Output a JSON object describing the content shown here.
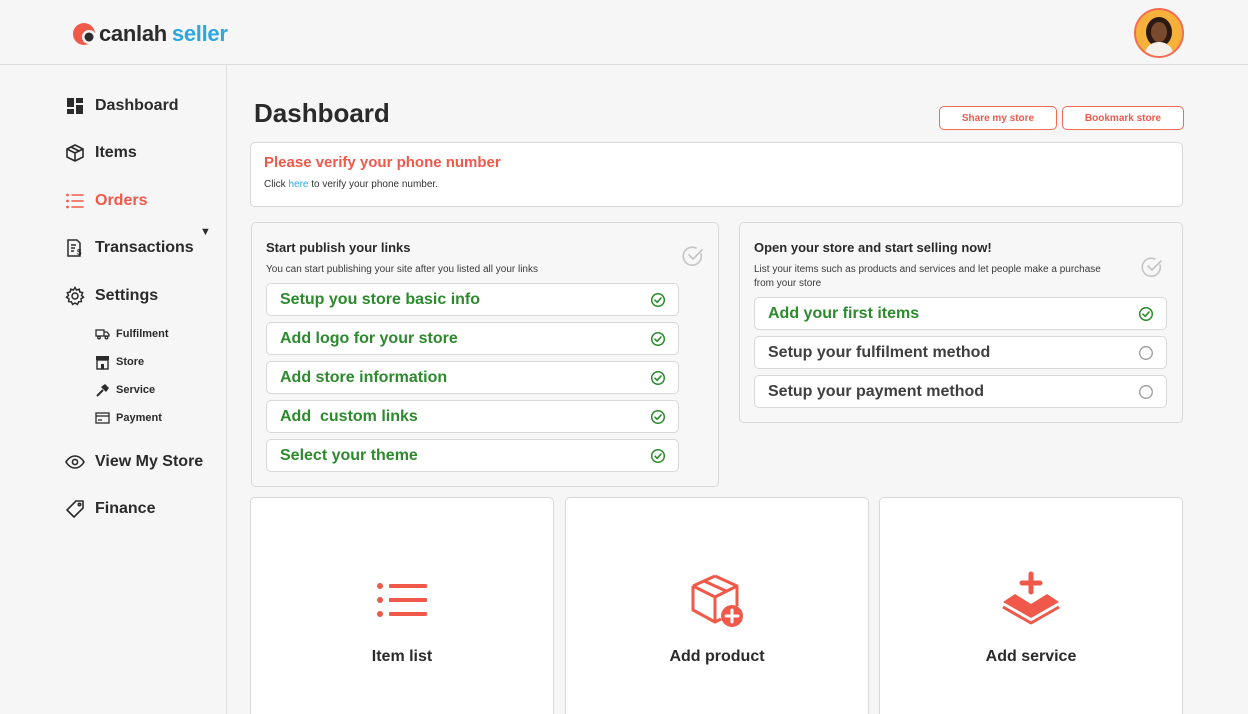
{
  "brand": {
    "name": "canlah",
    "suffix": "seller"
  },
  "colors": {
    "accent": "#f0594a",
    "success": "#2c8a2d",
    "link": "#2fa6e0"
  },
  "sidebar": {
    "items": [
      {
        "label": "Dashboard",
        "icon": "grid-icon"
      },
      {
        "label": "Items",
        "icon": "box-icon"
      },
      {
        "label": "Orders",
        "icon": "list-icon",
        "active": true
      },
      {
        "label": "Transactions",
        "icon": "receipt-icon"
      },
      {
        "label": "Settings",
        "icon": "gear-icon"
      },
      {
        "label": "View My Store",
        "icon": "eye-icon"
      },
      {
        "label": "Finance",
        "icon": "tag-icon"
      }
    ],
    "settings_sub": [
      {
        "label": "Fulfilment",
        "icon": "truck-icon"
      },
      {
        "label": "Store",
        "icon": "store-icon"
      },
      {
        "label": "Service",
        "icon": "hammer-icon"
      },
      {
        "label": "Payment",
        "icon": "card-icon"
      }
    ]
  },
  "main": {
    "title": "Dashboard",
    "share_label": "Share my store",
    "bookmark_label": "Bookmark store",
    "verify": {
      "title": "Please verify your phone number",
      "pre": "Click ",
      "link": "here",
      "post": " to verify your phone number."
    },
    "publish": {
      "title": "Start publish your links",
      "subtitle": "You can start publishing your site after you listed all your links",
      "tasks": [
        {
          "label": "Setup you store basic info",
          "done": true
        },
        {
          "label": "Add logo for your store",
          "done": true
        },
        {
          "label": "Add store information",
          "done": true
        },
        {
          "label": "Add  custom links",
          "done": true
        },
        {
          "label": "Select your theme",
          "done": true
        }
      ]
    },
    "selling": {
      "title": "Open your store and start selling now!",
      "subtitle_1": "List your items such as products and services and let people make a purchase",
      "subtitle_2": "from your store",
      "tasks": [
        {
          "label": "Add your first items",
          "done": true
        },
        {
          "label": "Setup your fulfilment method",
          "done": false
        },
        {
          "label": "Setup your payment method",
          "done": false
        }
      ]
    },
    "actions": [
      {
        "label": "Item list",
        "icon": "list-icon"
      },
      {
        "label": "Add product",
        "icon": "box-plus-icon"
      },
      {
        "label": "Add service",
        "icon": "layers-plus-icon"
      }
    ]
  }
}
